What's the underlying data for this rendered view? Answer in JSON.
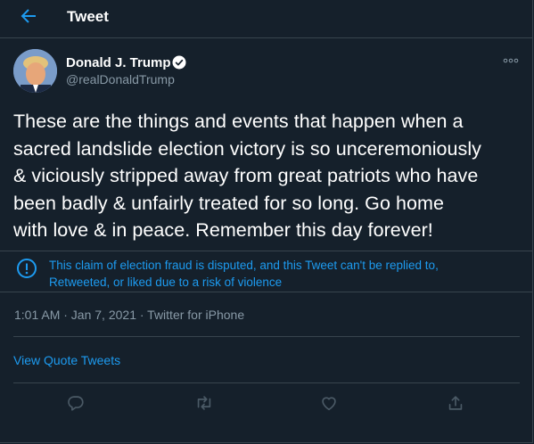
{
  "header": {
    "title": "Tweet",
    "back_icon": "arrow-left-icon"
  },
  "author": {
    "name": "Donald J. Trump",
    "handle": "@realDonaldTrump",
    "verified": true
  },
  "tweet": {
    "text_lines": [
      "These are the things and events that happen when a",
      "sacred landslide election victory is so unceremoniously",
      "& viciously stripped away from great patriots who have",
      "been badly & unfairly treated for so long. Go home",
      "with love & in peace. Remember this day forever!"
    ]
  },
  "notice": {
    "line1": "This claim of election fraud is disputed, and this Tweet can't be replied to,",
    "line2": "Retweeted, or liked due to a risk of violence"
  },
  "meta": {
    "text": "1:01 AM · Jan 7, 2021 · Twitter for iPhone"
  },
  "quotes_link": "View Quote Tweets",
  "actions": [
    "reply-icon",
    "retweet-icon",
    "like-icon",
    "share-icon"
  ],
  "colors": {
    "background": "#15202b",
    "accent": "#1d9bf0",
    "muted": "#8899a6",
    "border": "#38444d"
  }
}
